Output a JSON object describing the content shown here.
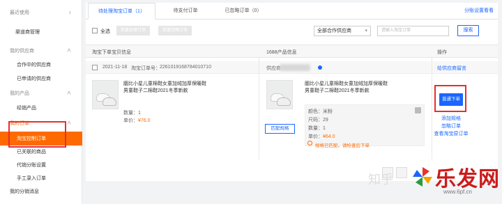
{
  "sidebar": {
    "items": [
      {
        "label": "最近使用",
        "type": "group",
        "chevron": "›"
      },
      {
        "label": "渠道商管理",
        "type": "item"
      },
      {
        "label": "我的供应商",
        "type": "group",
        "chevron": "˄"
      },
      {
        "label": "合作中的供应商",
        "type": "item"
      },
      {
        "label": "已申请的供应商",
        "type": "item"
      },
      {
        "label": "我的产品",
        "type": "group",
        "chevron": "˄"
      },
      {
        "label": "经销产品",
        "type": "item"
      },
      {
        "label": "我的订单",
        "type": "group",
        "chevron": "˄"
      },
      {
        "label": "淘宝控制订单",
        "type": "item",
        "active": true
      },
      {
        "label": "已关联的商品",
        "type": "item"
      },
      {
        "label": "代销分账设置",
        "type": "item"
      },
      {
        "label": "手工录入订单",
        "type": "item"
      },
      {
        "label": "我的分销消息",
        "type": "group"
      }
    ]
  },
  "tabs": [
    {
      "label": "待处理淘宝订单（1）",
      "active": true
    },
    {
      "label": "待支付订单",
      "active": false
    },
    {
      "label": "已忽略订单（0）",
      "active": false
    }
  ],
  "tab_right_link": "分账设置看看",
  "toolbar": {
    "select_all": "全选",
    "batch_btn_1": "批量处理订单",
    "batch_btn_2": "批量忽略订单",
    "supplier_select": "全部合作供应商",
    "select_arrow": "▾",
    "search_placeholder": "请输入淘宝订单",
    "search_btn": "搜索"
  },
  "table_header": {
    "col1": "淘宝下单宝贝信息",
    "col2": "1688产品信息",
    "col3": "操作"
  },
  "order": {
    "date": "2021-11-18",
    "order_no_label": "淘宝订单号：",
    "order_no": "2261019168784010710",
    "supplier_label": "供应商",
    "right_link": "给供应商留言",
    "taobao_title": "胭比小星儿童棉鞋女童加绒加厚保暖鞋男童鞋子二棉鞋2021冬季新款",
    "taobao_qty_label": "数量：",
    "taobao_qty": "1",
    "taobao_price_label": "单价：",
    "taobao_price": "¥76.0",
    "p1688_title": "胭比小星儿童棉鞋女童加绒加厚保暖鞋男童鞋子二棉鞋2021冬季新款",
    "spec_color_label": "颜色：",
    "spec_color": "米粉",
    "spec_size_label": "尺码：",
    "spec_size": "29",
    "spec_qty_label": "数量：",
    "spec_qty": "1",
    "spec_price_label": "单价：",
    "spec_price": "¥64.0",
    "match_btn": "匹配规格",
    "warning": "规格已匹配，请检查后下单",
    "action_primary": "普通下单",
    "action_links": [
      "添加规格",
      "忽略订单",
      "查看淘宝原订单"
    ]
  },
  "watermarks": {
    "zhihu": "知乎",
    "brand": "乐发网",
    "site": "www.6pf.cn"
  },
  "colors": {
    "accent": "#1a66ff",
    "sidebar_active": "#ff6a00",
    "price": "#ff6a00",
    "highlight_border": "#e62e2e"
  }
}
